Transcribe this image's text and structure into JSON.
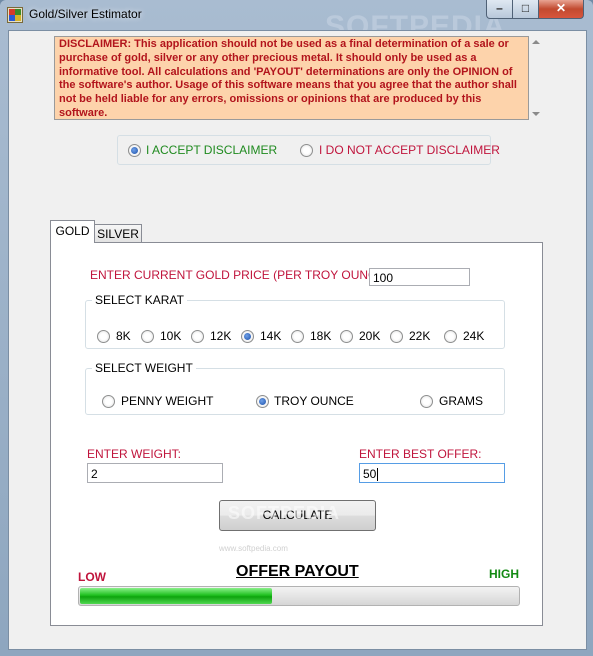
{
  "window": {
    "title": "Gold/Silver Estimator",
    "watermark": "SOFTPEDIA",
    "buttons": {
      "minimize": "–",
      "maximize": "□",
      "close": "✕"
    }
  },
  "disclaimer": {
    "text": "DISCLAIMER:  This application should not be used as a final determination of a sale or purchase of gold, silver or any other precious metal.  It should only be used as a informative tool. All calculations and 'PAYOUT' determinations are only the OPINION of the software's author.  Usage of this software means that you agree that the author shall not be held liable for any errors, omissions or opinions that are produced by this software."
  },
  "accept": {
    "accept_label": "I ACCEPT DISCLAIMER",
    "decline_label": "I DO NOT ACCEPT DISCLAIMER",
    "selected": "accept"
  },
  "tabs": [
    {
      "label": "GOLD",
      "active": true
    },
    {
      "label": "SILVER",
      "active": false
    }
  ],
  "gold": {
    "price_label": "ENTER CURRENT GOLD PRICE (PER TROY OUNCE):",
    "price_value": "100",
    "karat": {
      "title": "SELECT KARAT",
      "options": [
        "8K",
        "10K",
        "12K",
        "14K",
        "18K",
        "20K",
        "22K",
        "24K"
      ],
      "selected": "14K"
    },
    "weight": {
      "title": "SELECT WEIGHT",
      "options": [
        "PENNY WEIGHT",
        "TROY OUNCE",
        "GRAMS"
      ],
      "selected": "TROY OUNCE"
    },
    "weight_label": "ENTER WEIGHT:",
    "weight_value": "2",
    "offer_label": "ENTER BEST OFFER:",
    "offer_value": "50",
    "calculate_label": "CALCULATE",
    "calculate_watermark": "SOFTPEDIA",
    "site_watermark": "www.softpedia.com",
    "payout": {
      "title": "OFFER PAYOUT",
      "low_label": "LOW",
      "high_label": "HIGH",
      "level_percent": 44
    }
  },
  "colors": {
    "disclaimer_bg": "#fdd3ab",
    "disclaimer_text": "#b2141c",
    "accept_text": "#1f8a1f",
    "decline_text": "#c0143c",
    "label_red": "#c0143c",
    "high_green": "#138a13",
    "progress_green": "#20c020"
  }
}
